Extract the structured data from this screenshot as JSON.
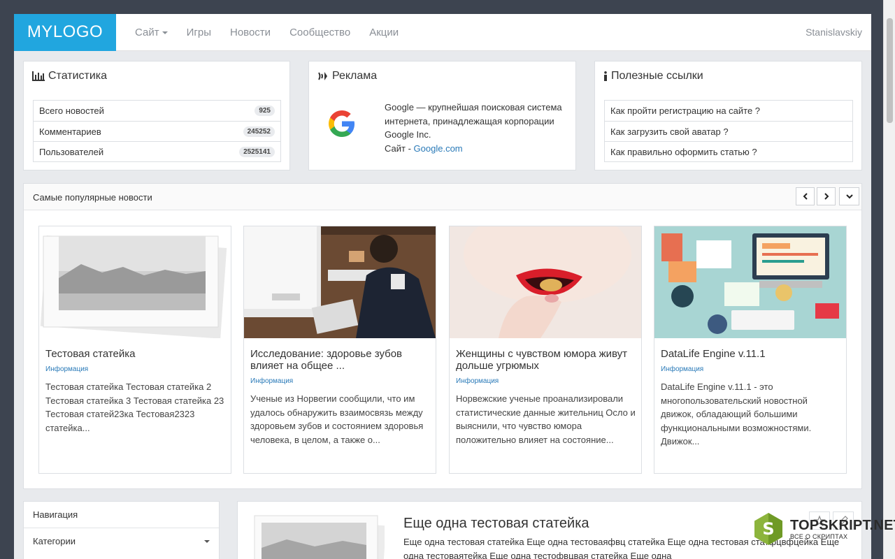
{
  "navbar": {
    "logo": "MYLOGO",
    "items": [
      {
        "label": "Сайт",
        "dropdown": true
      },
      {
        "label": "Игры"
      },
      {
        "label": "Новости"
      },
      {
        "label": "Сообщество"
      },
      {
        "label": "Акции"
      }
    ],
    "user": "Stanislavskiy"
  },
  "stats": {
    "title": "Статистика",
    "rows": [
      {
        "label": "Всего новостей",
        "value": "925"
      },
      {
        "label": "Комментариев",
        "value": "245252"
      },
      {
        "label": "Пользователей",
        "value": "2525141"
      }
    ]
  },
  "ad": {
    "title": "Реклама",
    "text": "Google — крупнейшая поисковая система интернета, принадлежащая корпорации Google Inc.",
    "site_label": "Сайт - ",
    "site_link": "Google.com"
  },
  "links": {
    "title": "Полезные ссылки",
    "items": [
      "Как пройти регистрацию на сайте ?",
      "Как загрузить свой аватар ?",
      "Как правильно оформить статью ?"
    ]
  },
  "popular": {
    "title": "Самые популярные новости",
    "cards": [
      {
        "title": "Тестовая статейка",
        "category": "Информация",
        "text": "Тестовая статейка Тестовая статейка 2 Тестовая статейка  3 Тестовая статейка 23 Тестовая статей23ка Тестовая2323 статейка..."
      },
      {
        "title": "Исследование: здоровье зубов влияет на общее ...",
        "category": "Информация",
        "text": "Ученые из Норвегии сообщили, что им удалось обнаружить взаимосвязь между здоровьем зубов и состоянием здоровья человека, в целом, а также о..."
      },
      {
        "title": "Женщины с чувством юмора живут дольше угрюмых",
        "category": "Информация",
        "text": "Норвежские ученые проанализировали статистические данные жительниц Осло и выяснили, что чувство юмора положительно влияет на состояние..."
      },
      {
        "title": "DataLife Engine v.11.1",
        "category": "Информация",
        "text": "DataLife Engine v.11.1 - это многопользовательский новостной движок, обладающий большими функциональными возможностями. Движок..."
      }
    ]
  },
  "sidebar": {
    "title": "Навигация",
    "categories_label": "Категории"
  },
  "article": {
    "title": "Еще одна тестовая статейка",
    "text": "Еще одна тестовая статейка Еще одна тестоваяфвц статейка Еще одна тестовая статфцвфцейка Еще одна тестоваятейка Еще одна тестофвцвая статейка Еще одна"
  },
  "watermark": {
    "main": "TOPSKRIPT.NET",
    "sub": "ВСЕ О СКРИПТАХ"
  },
  "colors": {
    "brand": "#21a6df",
    "link": "#2a7ab8",
    "background": "#e8eaed"
  }
}
